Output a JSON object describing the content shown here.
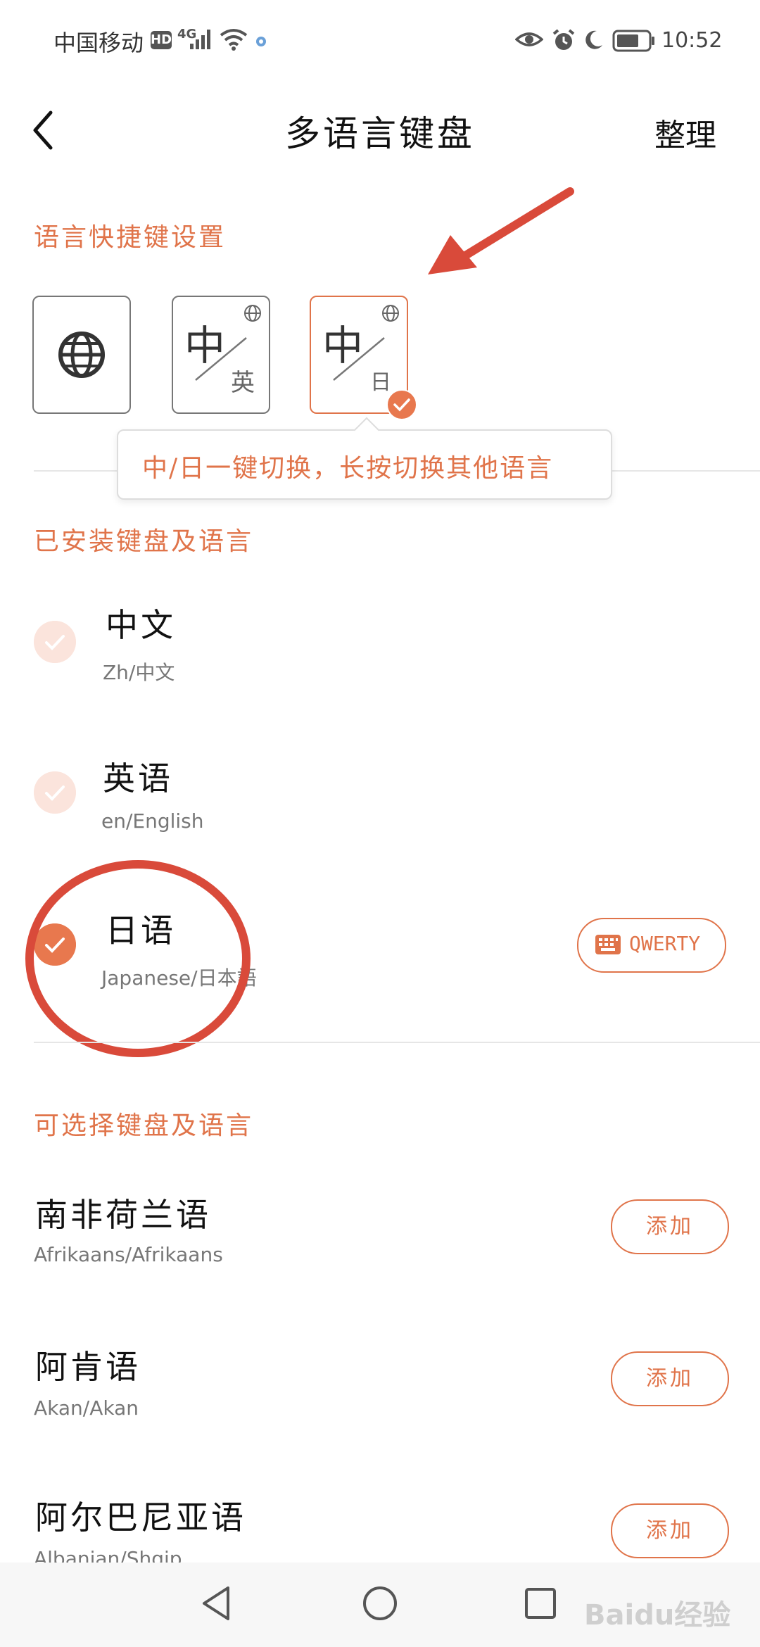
{
  "status_bar": {
    "carrier": "中国移动",
    "hd_badge": "HD",
    "network": "4G",
    "time": "10:52"
  },
  "header": {
    "title": "多语言键盘",
    "manage_label": "整理"
  },
  "shortcut_section": {
    "heading": "语言快捷键设置",
    "tiles": [
      {
        "icon": "globe-icon",
        "selected": false
      },
      {
        "main": "中",
        "sub": "英",
        "selected": false
      },
      {
        "main": "中",
        "sub": "日",
        "selected": true
      }
    ],
    "tooltip": "中/日一键切换，长按切换其他语言"
  },
  "installed_section": {
    "heading": "已安装键盘及语言",
    "items": [
      {
        "name": "中文",
        "sub": "Zh/中文",
        "checked": false
      },
      {
        "name": "英语",
        "sub": "en/English",
        "checked": false
      },
      {
        "name": "日语",
        "sub": "Japanese/日本語",
        "checked": true,
        "layout_button": "QWERTY"
      }
    ]
  },
  "available_section": {
    "heading": "可选择键盘及语言",
    "items": [
      {
        "name": "南非荷兰语",
        "sub": "Afrikaans/Afrikaans",
        "button": "添加"
      },
      {
        "name": "阿肯语",
        "sub": "Akan/Akan",
        "button": "添加"
      },
      {
        "name": "阿尔巴尼亚语",
        "sub": "Albanian/Shqip",
        "button": "添加"
      }
    ]
  },
  "watermark": "Baidu经验",
  "colors": {
    "accent": "#e0744a",
    "annotation": "#d94a3a"
  }
}
